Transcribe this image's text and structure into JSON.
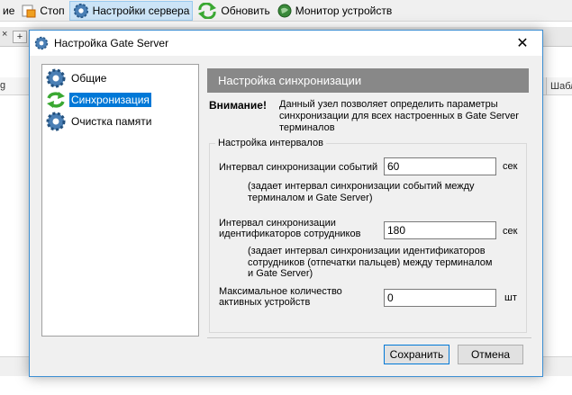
{
  "app": {
    "toolbar": [
      {
        "label": "ие",
        "icon": "unknown-partial-icon"
      },
      {
        "label": "Стоп",
        "icon": "stop-icon"
      },
      {
        "label": "Настройки сервера",
        "icon": "gear-icon",
        "active": true
      },
      {
        "label": "Обновить",
        "icon": "refresh-icon"
      },
      {
        "label": "Монитор устройств",
        "icon": "monitor-globe-icon"
      }
    ],
    "tab_close": "×",
    "tab_add": "+",
    "grid_left_header": "g",
    "grid_right_header": "Шабл"
  },
  "dialog": {
    "title": "Настройка Gate Server",
    "close_glyph": "✕",
    "nav": [
      {
        "label": "Общие",
        "icon": "gear-icon",
        "selected": false
      },
      {
        "label": "Синхронизация",
        "icon": "sync-arrows-icon",
        "selected": true
      },
      {
        "label": "Очистка памяти",
        "icon": "gear-icon",
        "selected": false
      }
    ],
    "header": "Настройка синхронизации",
    "warning_label": "Внимание!",
    "warning_text": "Данный узел позволяет определить параметры синхронизации для всех настроенных в Gate Server терминалов",
    "group_title": "Настройка интервалов",
    "events_interval": {
      "label": "Интервал синхронизации событий",
      "value": "60",
      "unit": "сек",
      "hint_line1": "(задает интервал синхронизации событий между",
      "hint_line2": "терминалом и Gate Server)"
    },
    "ids_interval": {
      "label_line1": "Интервал синхронизации",
      "label_line2": "идентификаторов сотрудников",
      "value": "180",
      "unit": "сек",
      "hint_line1": "(задает интервал синхронизации  идентификаторов",
      "hint_line2": "сотрудников (отпечатки пальцев) между терминалом",
      "hint_line3": "и Gate Server)"
    },
    "max_devices": {
      "label_line1": "Максимальное количество",
      "label_line2": "активных устройств",
      "value": "0",
      "unit": "шт"
    },
    "save_label": "Сохранить",
    "cancel_label": "Отмена"
  },
  "colors": {
    "accent": "#0078d7",
    "header_bg": "#888888",
    "dialog_bg": "#f0f0f0"
  }
}
